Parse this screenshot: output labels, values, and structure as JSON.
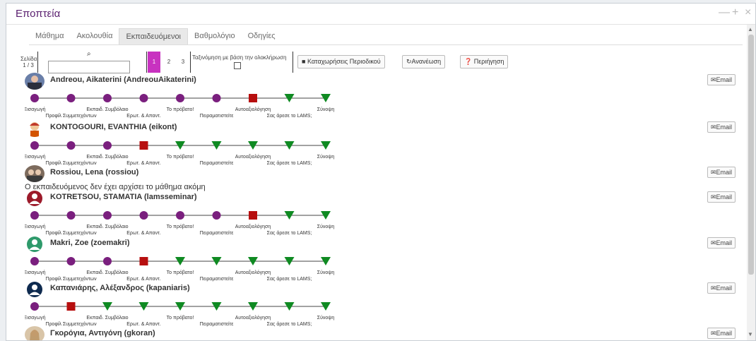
{
  "window": {
    "title": "Εποπτεία",
    "controls": [
      "—",
      "+",
      "×"
    ]
  },
  "tabs": [
    {
      "label": "Μάθημα",
      "active": false
    },
    {
      "label": "Ακολουθία",
      "active": false
    },
    {
      "label": "Εκπαιδευόμενοι",
      "active": true
    },
    {
      "label": "Βαθμολόγιο",
      "active": false
    },
    {
      "label": "Οδηγίες",
      "active": false
    }
  ],
  "toolbar": {
    "page_label": "Σελίδα",
    "page_count": "1 / 3",
    "search_placeholder": "",
    "pages": [
      "1",
      "2",
      "3"
    ],
    "sort_label": "Ταξινόμηση με βάση την ολοκλήρωση",
    "btn_journal": "Καταχωρήσεις Περιοδικού",
    "btn_refresh": "Ανανέωση",
    "btn_tour": "Περιήγηση"
  },
  "email_label": "Email",
  "not_started_text": "Ο εκπαιδευόμενος δεν έχει αρχίσει το μάθημα ακόμη",
  "activity_labels_top": [
    "Εισαγωγή",
    "Εκπαιδ. Συμβόλαιο",
    "Το πρόβατο!",
    "Αυτοαξιολόγηση",
    "Σύνοψη"
  ],
  "activity_labels_bottom": [
    "Προφίλ Συμμετεχόντων",
    "Ερωτ. & Απαντ.",
    "Πειραματιστείτε",
    "Σας άρεσε το LAMS;"
  ],
  "colors": {
    "completed": "#7a1f7e",
    "current": "#b70f0f",
    "pending": "#0f8a22",
    "accent": "#c832c0",
    "title": "#5b2170"
  },
  "learners": [
    {
      "name": "Andreou, Aikaterini (AndreouAikaterini)",
      "avatar": "photo",
      "progress": [
        "c",
        "c",
        "c",
        "c",
        "c",
        "c",
        "x",
        "p",
        "p"
      ]
    },
    {
      "name": "KONTOGOURI, EVANTHIA (eikont)",
      "avatar": "cartoon",
      "progress": [
        "c",
        "c",
        "c",
        "x",
        "p",
        "p",
        "p",
        "p",
        "p"
      ]
    },
    {
      "name": "Rossiou, Lena (rossiou)",
      "avatar": "photo-group",
      "progress": []
    },
    {
      "name": "KOTRETSOU, STAMATIA (lamsseminar)",
      "avatar": "user-maroon",
      "progress": [
        "c",
        "c",
        "c",
        "c",
        "c",
        "c",
        "x",
        "p",
        "p"
      ]
    },
    {
      "name": "Makri, Zoe (zoemakri)",
      "avatar": "user-green",
      "progress": [
        "c",
        "c",
        "c",
        "x",
        "p",
        "p",
        "p",
        "p",
        "p"
      ]
    },
    {
      "name": "Καπανιάρης, Αλέξανδρος (kapaniaris)",
      "avatar": "user-navy",
      "progress": [
        "c",
        "x",
        "p",
        "p",
        "p",
        "p",
        "p",
        "p",
        "p"
      ]
    },
    {
      "name": "Γκορόγια, Αντιγόνη (gkoran)",
      "avatar": "photo-woman",
      "progress": []
    }
  ]
}
